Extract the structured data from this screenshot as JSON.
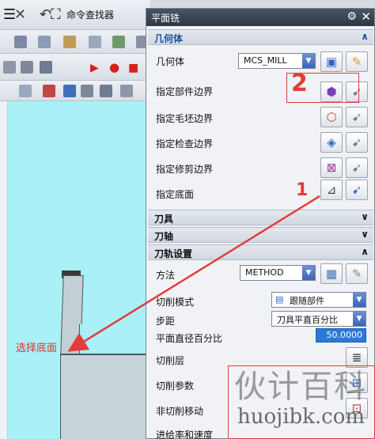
{
  "app": {
    "toolbar": {
      "command_finder_label": "命令查找器"
    },
    "viewport_annotation": "选择底面"
  },
  "dialog": {
    "title": "平面铣",
    "sections": {
      "geometry": {
        "header": "几何体",
        "geometry_label": "几何体",
        "geometry_value": "MCS_MILL",
        "rows": [
          "指定部件边界",
          "指定毛坯边界",
          "指定检查边界",
          "指定修剪边界",
          "指定底面"
        ]
      },
      "tool": {
        "header": "刀具"
      },
      "axis": {
        "header": "刀轴"
      },
      "path": {
        "header": "刀轨设置",
        "method_label": "方法",
        "method_value": "METHOD",
        "cut_pattern_label": "切削模式",
        "cut_pattern_value": "跟随部件",
        "stepover_label": "步距",
        "stepover_value": "刀具平直百分比",
        "diameter_pct_label": "平面直径百分比",
        "diameter_pct_value": "50.0000",
        "cut_levels_label": "切削层",
        "cut_params_label": "切削参数",
        "non_cut_label": "非切削移动",
        "feeds_label": "进给率和速度"
      }
    }
  },
  "watermark": {
    "cn": "伙计百科",
    "en": "huojibk.com"
  },
  "colors": {
    "annotation_red": "#e23c3c",
    "viewport_cyan": "#a9f1f7",
    "title_dark": "#2e3844",
    "value_highlight": "#2b79d9"
  }
}
